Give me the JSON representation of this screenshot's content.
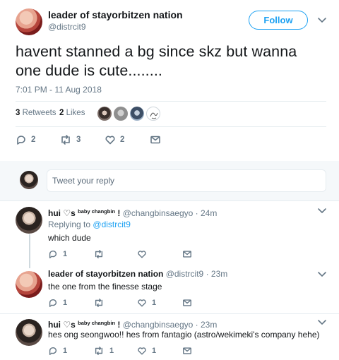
{
  "header": {
    "display_name": "leader of stayorbitzen nation",
    "handle": "@distrcit9",
    "follow_label": "Follow"
  },
  "tweet": {
    "text": "havent stanned a bg since skz but wanna one dude is cute........",
    "timestamp": "7:01 PM - 11 Aug 2018",
    "retweets_count": "3",
    "retweets_label": "Retweets",
    "likes_count": "2",
    "likes_label": "Likes",
    "reply_count": "2",
    "retweet_count": "3",
    "like_count": "2"
  },
  "compose": {
    "placeholder": "Tweet your reply"
  },
  "replies": [
    {
      "name_prefix": "hui ",
      "name_heart": "♡",
      "name_s": "s",
      "name_sup": "baby changbin",
      "name_bang": " !",
      "handle": "@changbinsaegyo",
      "time": "· 24m",
      "replying_label": "Replying to",
      "replying_to": "@distrcit9",
      "text": "which dude",
      "reply_count": "1",
      "retweet_count": "",
      "like_count": ""
    },
    {
      "name": "leader of stayorbitzen nation",
      "handle": "@distrcit9",
      "time": "· 23m",
      "text": "the one from the finesse stage",
      "reply_count": "1",
      "retweet_count": "",
      "like_count": "1"
    },
    {
      "name_prefix": "hui ",
      "name_heart": "♡",
      "name_s": "s",
      "name_sup": "baby changbin",
      "name_bang": " !",
      "handle": "@changbinsaegyo",
      "time": "· 23m",
      "text": "hes ong seongwoo!! hes from fantagio (astro/wekimeki's company hehe)",
      "reply_count": "1",
      "retweet_count": "1",
      "like_count": "1"
    }
  ],
  "colors": {
    "accent": "#1da1f2",
    "muted": "#657786",
    "divider": "#e6ecf0"
  },
  "icons": [
    "reply-icon",
    "retweet-icon",
    "heart-icon",
    "message-icon",
    "chevron-down-icon"
  ]
}
